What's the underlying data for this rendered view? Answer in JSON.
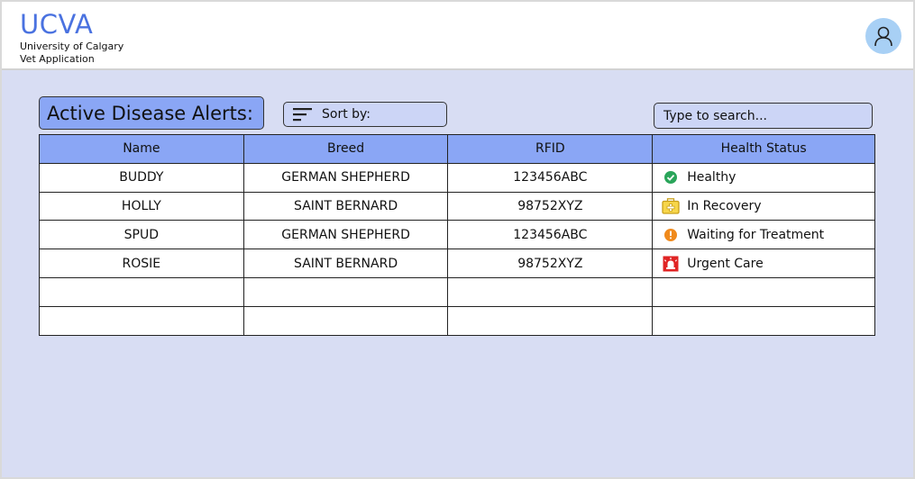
{
  "header": {
    "logo": "UCVA",
    "subtitle_line1": "University of Calgary",
    "subtitle_line2": "Vet Application",
    "avatar_icon": "user-icon"
  },
  "toolbar": {
    "title": "Active Disease Alerts:",
    "sort_label": "Sort by:",
    "sort_icon": "sort-icon",
    "search_placeholder": "Type to search..."
  },
  "table": {
    "columns": [
      "Name",
      "Breed",
      "RFID",
      "Health Status"
    ],
    "rows": [
      {
        "name": "BUDDY",
        "breed": "GERMAN SHEPHERD",
        "rfid": "123456ABC",
        "status": "Healthy",
        "status_icon": "check-circle-icon"
      },
      {
        "name": "HOLLY",
        "breed": "SAINT BERNARD",
        "rfid": "98752XYZ",
        "status": "In Recovery",
        "status_icon": "medical-kit-icon"
      },
      {
        "name": "SPUD",
        "breed": "GERMAN SHEPHERD",
        "rfid": "123456ABC",
        "status": "Waiting for Treatment",
        "status_icon": "exclamation-circle-icon"
      },
      {
        "name": "ROSIE",
        "breed": "SAINT BERNARD",
        "rfid": "98752XYZ",
        "status": "Urgent Care",
        "status_icon": "alarm-siren-icon"
      }
    ],
    "empty_rows": 2
  },
  "colors": {
    "brand": "#4a72e0",
    "header_cell": "#8aa6f5",
    "background": "#d8ddf3",
    "healthy": "#2aa55a",
    "recovery": "#e0b21a",
    "waiting": "#f08a1c",
    "urgent": "#e02424"
  }
}
